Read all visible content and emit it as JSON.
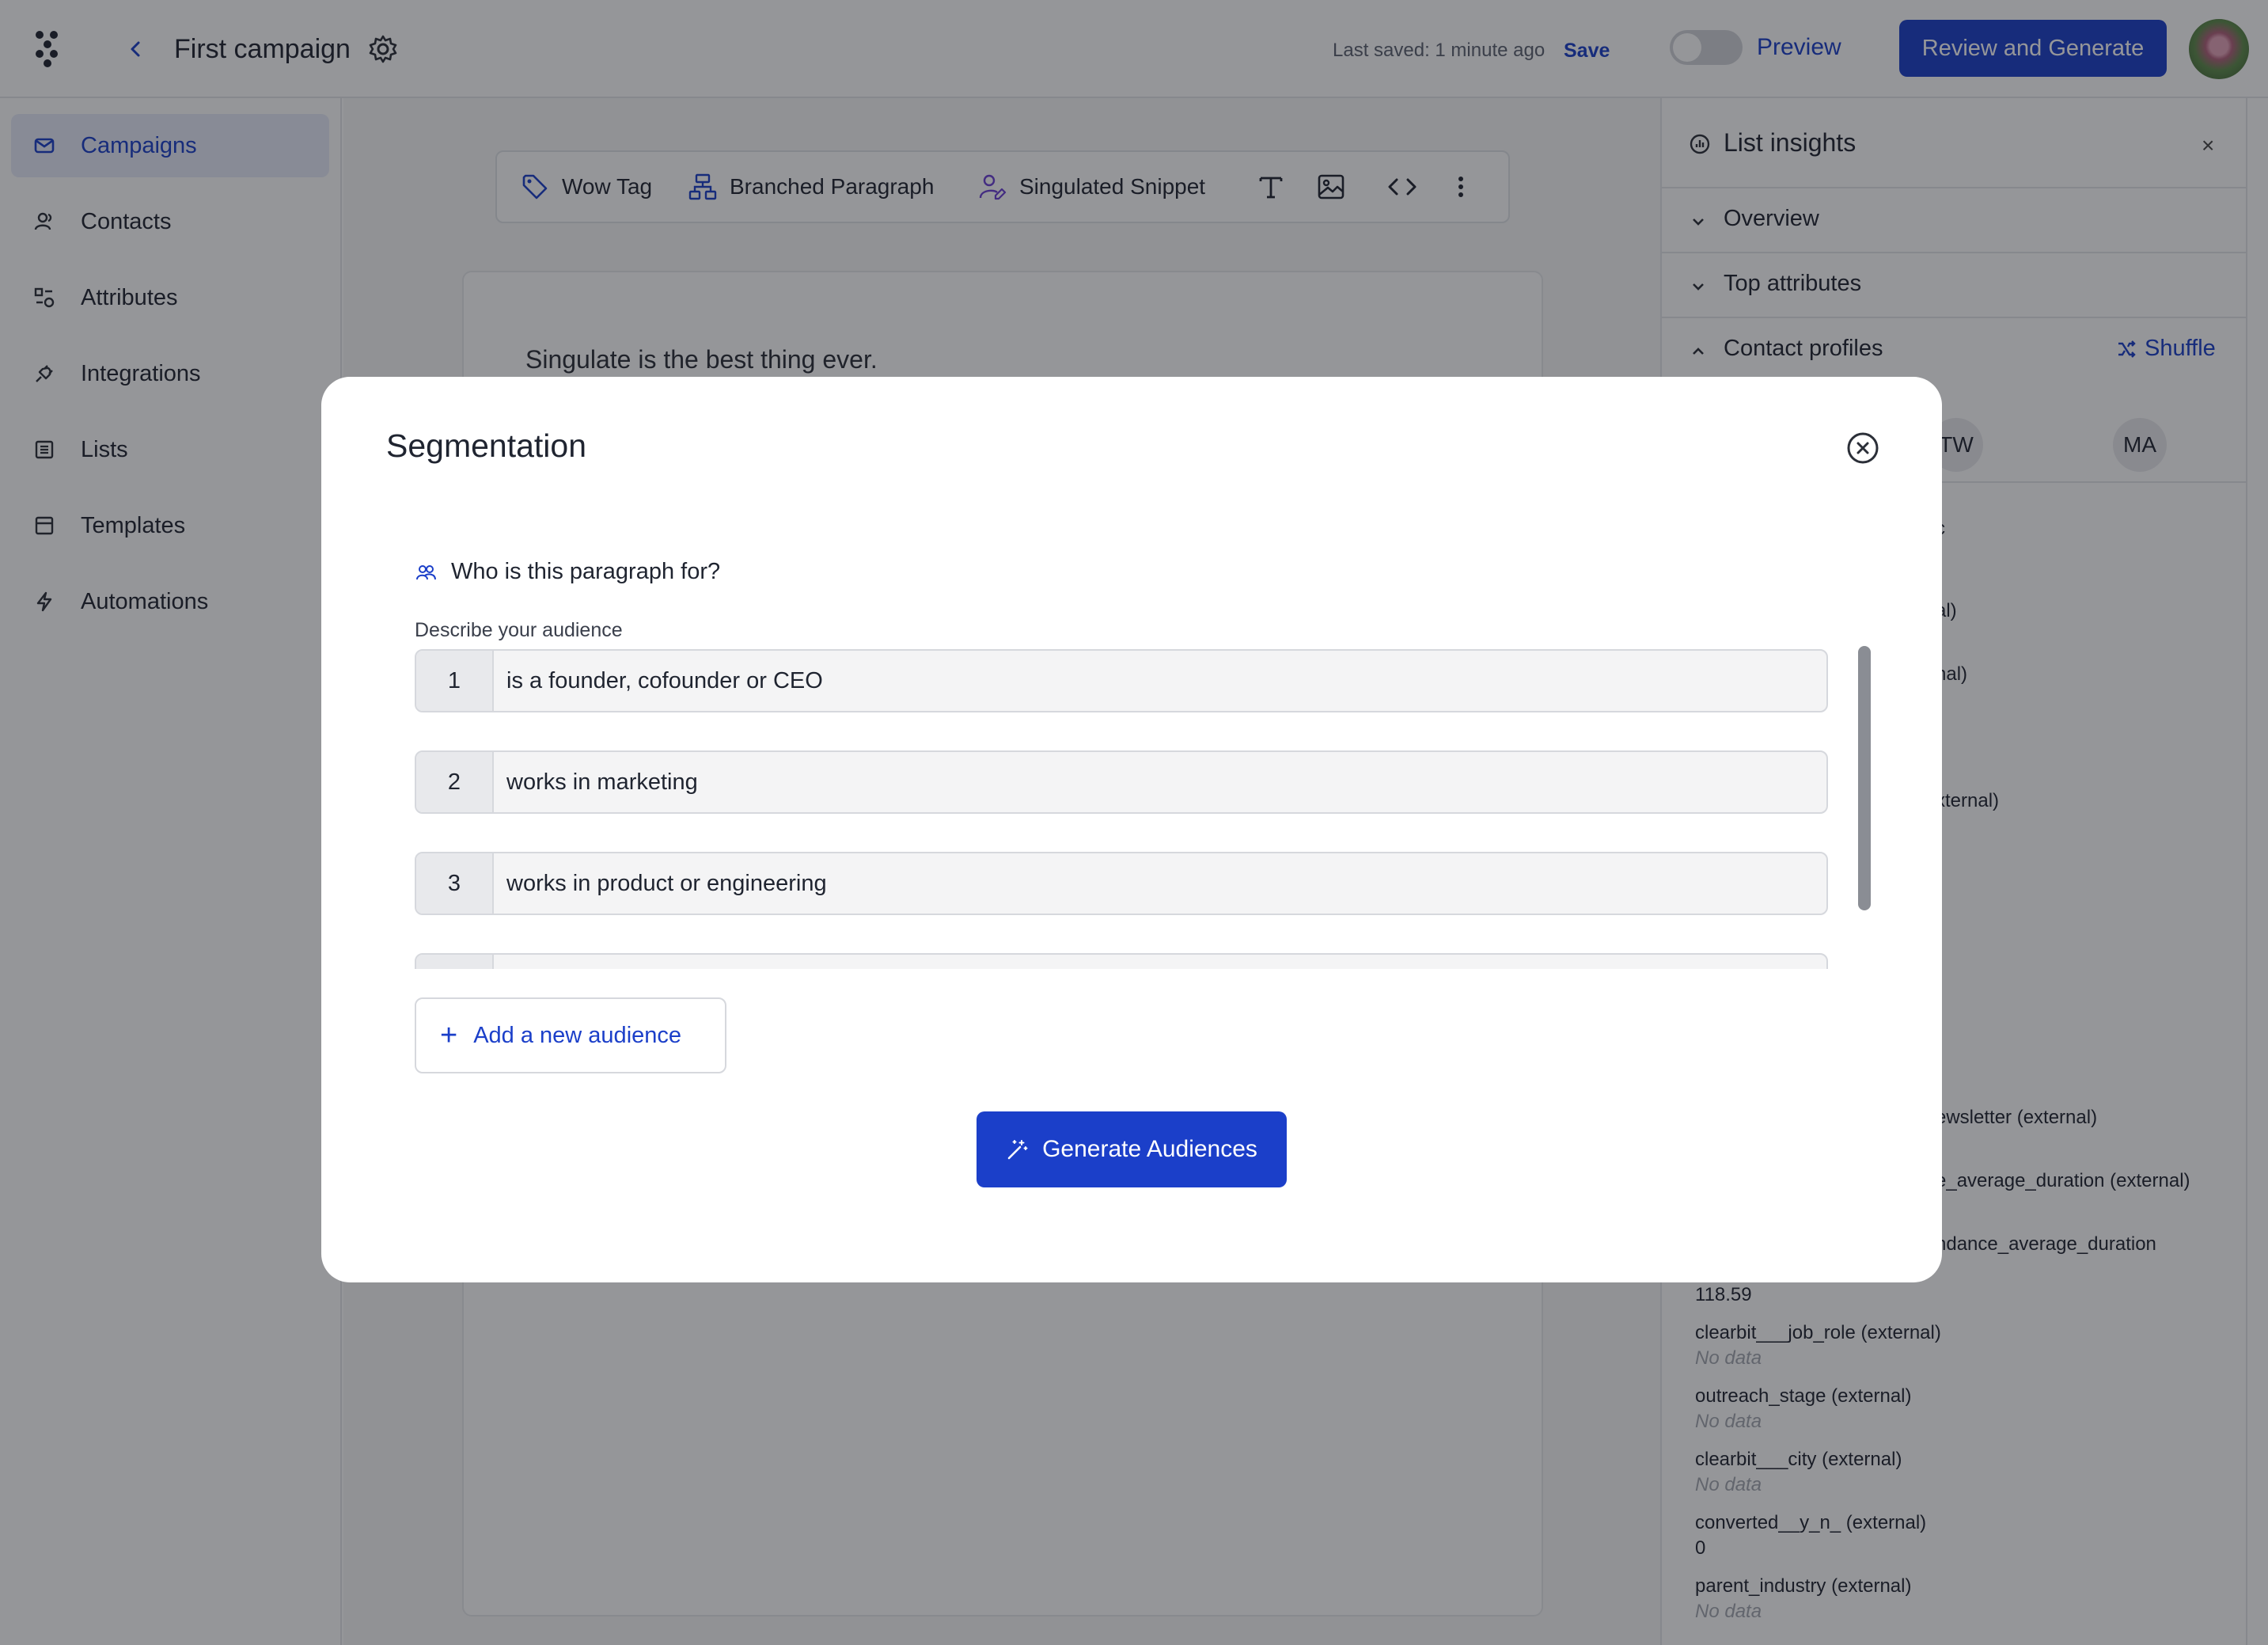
{
  "header": {
    "campaign_title": "First campaign",
    "last_saved": "Last saved: 1 minute ago",
    "save_label": "Save",
    "preview_label": "Preview",
    "review_label": "Review and Generate"
  },
  "sidebar": {
    "items": [
      {
        "label": "Campaigns",
        "icon": "mail-icon",
        "active": true
      },
      {
        "label": "Contacts",
        "icon": "users-icon"
      },
      {
        "label": "Attributes",
        "icon": "attributes-icon"
      },
      {
        "label": "Integrations",
        "icon": "plug-icon"
      },
      {
        "label": "Lists",
        "icon": "list-icon"
      },
      {
        "label": "Templates",
        "icon": "template-icon"
      },
      {
        "label": "Automations",
        "icon": "bolt-icon"
      }
    ]
  },
  "toolbar": {
    "wow_tag": "Wow Tag",
    "branched_paragraph": "Branched Paragraph",
    "singulated_snippet": "Singulated Snippet"
  },
  "editor": {
    "body_text": "Singulate is the best thing ever."
  },
  "insights": {
    "title": "List insights",
    "close": "×",
    "sections": {
      "overview": "Overview",
      "top_attributes": "Top attributes",
      "contact_profiles": "Contact profiles"
    },
    "shuffle_label": "Shuffle",
    "initials": [
      "TW",
      "MA"
    ],
    "partial_fragments": [
      "c",
      "al)",
      "nal)",
      "xternal)",
      "ewsletter (external)",
      "e_average_duration (external)",
      "ndance_average_duration"
    ],
    "attributes": [
      {
        "name": "",
        "value": "118.59"
      },
      {
        "name": "clearbit___job_role (external)",
        "value": "No data"
      },
      {
        "name": "outreach_stage (external)",
        "value": "No data"
      },
      {
        "name": "clearbit___city (external)",
        "value": "No data"
      },
      {
        "name": "converted__y_n_ (external)",
        "value": "0"
      },
      {
        "name": "parent_industry (external)",
        "value": "No data"
      }
    ]
  },
  "modal": {
    "title": "Segmentation",
    "question": "Who is this paragraph for?",
    "describe_label": "Describe your audience",
    "audiences": [
      {
        "num": "1",
        "text": "is a founder, cofounder or CEO"
      },
      {
        "num": "2",
        "text": "works in marketing"
      },
      {
        "num": "3",
        "text": "works in product or engineering"
      },
      {
        "num": "",
        "text": ""
      }
    ],
    "add_label": "Add a new audience",
    "generate_label": "Generate Audiences"
  },
  "colors": {
    "accent": "#1b3fc9",
    "active_nav_bg": "#e7ecf9",
    "overlay": "rgba(20,22,28,0.45)"
  }
}
